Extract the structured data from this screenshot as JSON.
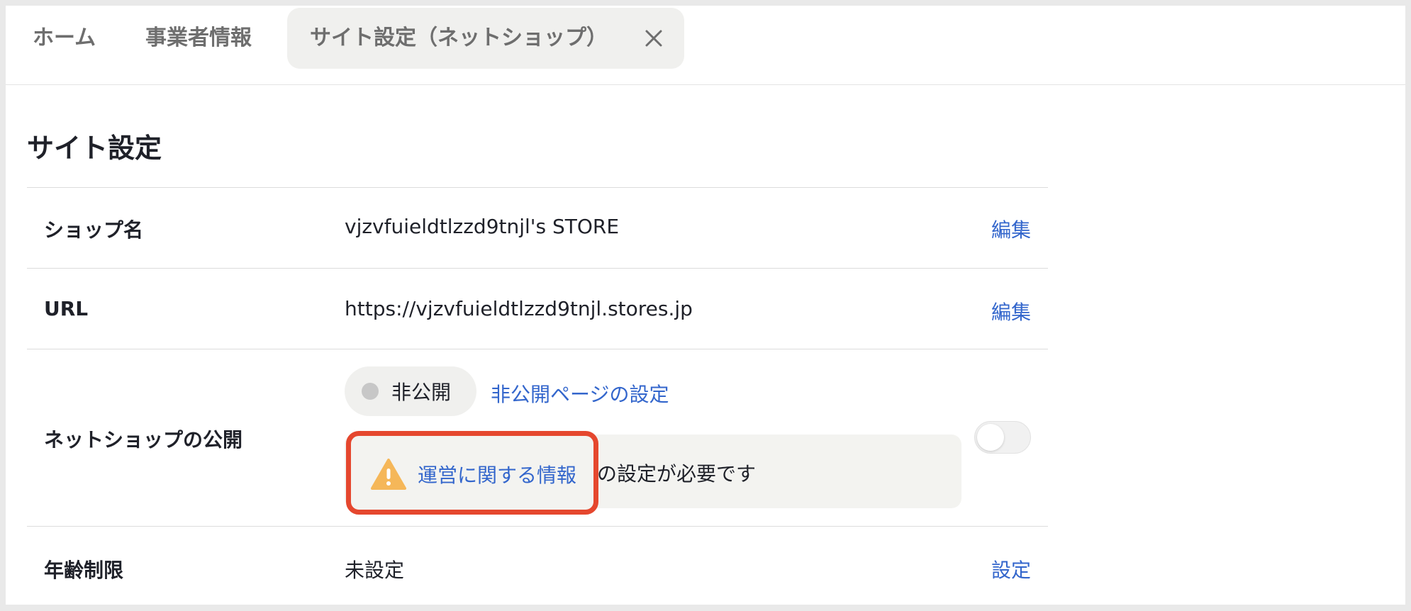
{
  "tabs": {
    "home": "ホーム",
    "business_info": "事業者情報",
    "active": "サイト設定（ネットショップ）"
  },
  "page": {
    "title": "サイト設定"
  },
  "settings": {
    "shop_name": {
      "label": "ショップ名",
      "value": "vjzvfuieldtlzzd9tnjl's STORE",
      "action": "編集"
    },
    "url": {
      "label": "URL",
      "value": "https://vjzvfuieldtlzzd9tnjl.stores.jp",
      "action": "編集"
    },
    "publish": {
      "label": "ネットショップの公開",
      "status": "非公開",
      "private_page_link": "非公開ページの設定",
      "notice_link": "運営に関する情報",
      "notice_text": "の設定が必要です",
      "toggle_on": false
    },
    "age_restriction": {
      "label": "年齢制限",
      "value": "未設定",
      "action": "設定"
    }
  },
  "colors": {
    "link": "#3366cc",
    "highlight": "#e5472e",
    "warning": "#f5b759"
  }
}
